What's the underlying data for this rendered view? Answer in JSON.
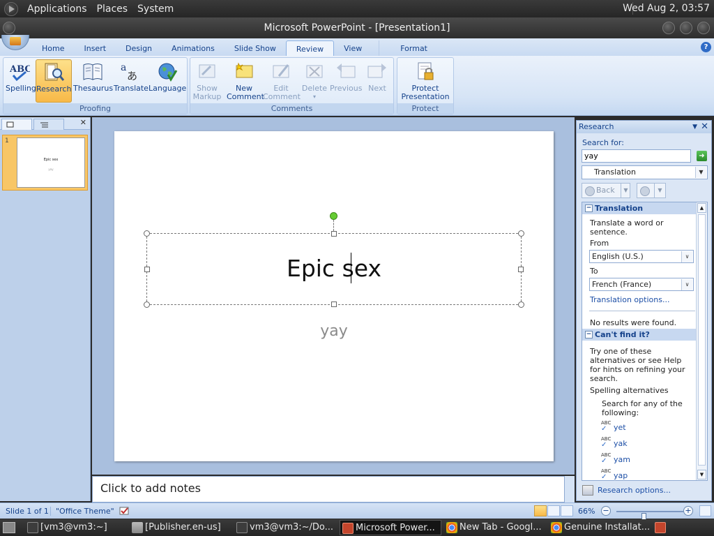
{
  "top_panel": {
    "menus": [
      "Applications",
      "Places",
      "System"
    ],
    "clock": "Wed Aug  2, 03:57"
  },
  "window": {
    "title": "Microsoft PowerPoint - [Presentation1]"
  },
  "ribbon": {
    "tabs": [
      "Home",
      "Insert",
      "Design",
      "Animations",
      "Slide Show",
      "Review",
      "View",
      "Format"
    ],
    "active_tab": "Review",
    "groups": {
      "proofing": {
        "label": "Proofing",
        "buttons": [
          "Spelling",
          "Research",
          "Thesaurus",
          "Translate",
          "Language"
        ]
      },
      "comments": {
        "label": "Comments",
        "show_markup": [
          "Show",
          "Markup"
        ],
        "new_comment": [
          "New",
          "Comment"
        ],
        "edit_comment": [
          "Edit",
          "Comment"
        ],
        "delete": "Delete",
        "previous": "Previous",
        "next": "Next"
      },
      "protect": {
        "label": "Protect",
        "protect_presentation": [
          "Protect",
          "Presentation"
        ]
      }
    }
  },
  "slide": {
    "title": "Epic sex",
    "subtitle": "yay",
    "thumb_number": "1"
  },
  "notes": {
    "placeholder": "Click to add notes"
  },
  "research": {
    "header": "Research",
    "search_label": "Search for:",
    "search_value": "yay",
    "source": "Translation",
    "back": "Back",
    "translation_section": "Translation",
    "translate_hint": "Translate a word or sentence.",
    "from_label": "From",
    "from_value": "English (U.S.)",
    "to_label": "To",
    "to_value": "French (France)",
    "options_link": "Translation options...",
    "no_results": "No results were found.",
    "cant_find": "Can't find it?",
    "try_text": "Try one of these alternatives or see Help for hints on refining your search.",
    "spelling_alternatives": "Spelling alternatives",
    "search_any": "Search for any of the following:",
    "alternatives": [
      "yet",
      "yak",
      "yam",
      "yap"
    ],
    "research_options": "Research options..."
  },
  "status": {
    "slide": "Slide 1 of 1",
    "theme": "\"Office Theme\"",
    "zoom": "66%",
    "zoom_fraction": 0.4
  },
  "taskbar": {
    "items": [
      "[vm3@vm3:~]",
      "[Publisher.en-us]",
      "vm3@vm3:~/Do...",
      "Microsoft Power...",
      "New Tab - Googl...",
      "Genuine Installat..."
    ]
  }
}
